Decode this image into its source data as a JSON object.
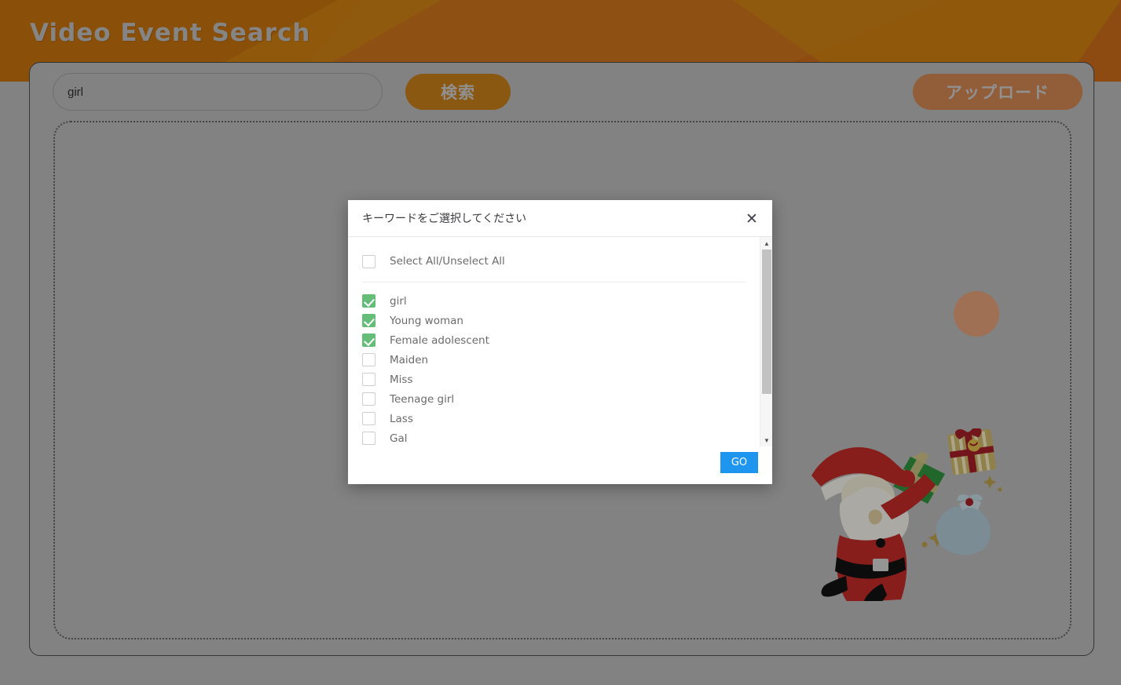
{
  "banner": {
    "title": "Video  Event  Search",
    "bg_color": "#c67a10",
    "accent_color": "#c4691a"
  },
  "toolbar": {
    "search_value": "girl",
    "search_placeholder": "",
    "search_button_label": "検索",
    "upload_button_label": "アップロード",
    "search_button_color": "#c07a18",
    "upload_button_color": "#cb824f"
  },
  "dropzone": {
    "decor": {
      "circle_color": "#dd9b73",
      "santa_illustration": "santa-claus-with-gifts"
    }
  },
  "modal": {
    "title": "キーワードをご選択してください",
    "close_label": "✕",
    "select_all_label": "Select All/Unselect All",
    "select_all_checked": false,
    "checkbox_checked_color": "#65bd78",
    "go_button_label": "GO",
    "go_button_color": "#1e96f0",
    "keywords": [
      {
        "label": "girl",
        "checked": true
      },
      {
        "label": "Young woman",
        "checked": true
      },
      {
        "label": "Female adolescent",
        "checked": true
      },
      {
        "label": "Maiden",
        "checked": false
      },
      {
        "label": "Miss",
        "checked": false
      },
      {
        "label": "Teenage girl",
        "checked": false
      },
      {
        "label": "Lass",
        "checked": false
      },
      {
        "label": "Gal",
        "checked": false
      },
      {
        "label": "",
        "checked": false
      }
    ],
    "scrollbar": {
      "up_glyph": "▲",
      "down_glyph": "▼"
    }
  }
}
